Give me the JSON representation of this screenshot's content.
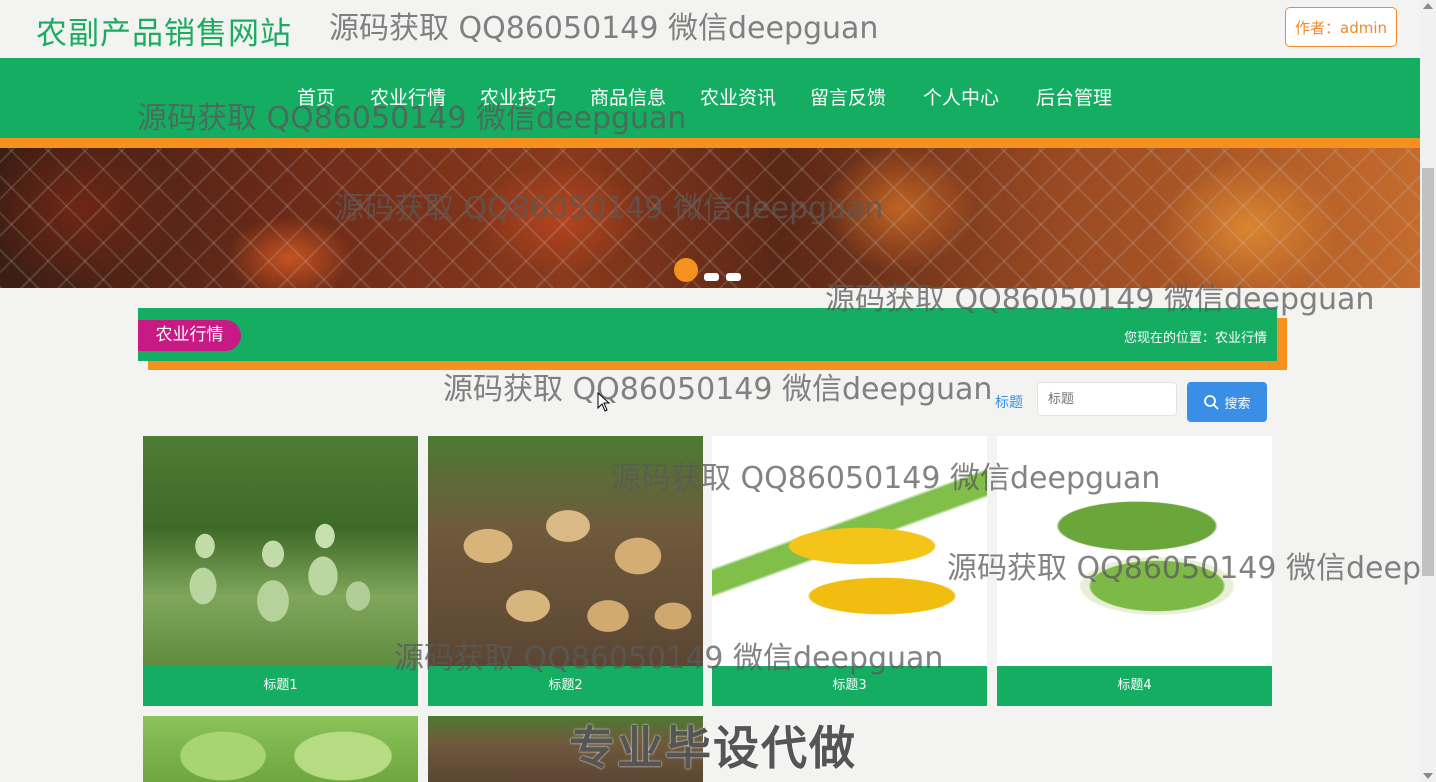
{
  "header": {
    "site_title": "农副产品销售网站",
    "author_button": "作者：admin"
  },
  "nav": {
    "items": [
      "首页",
      "农业行情",
      "农业技巧",
      "商品信息",
      "农业资讯",
      "留言反馈",
      "个人中心",
      "后台管理"
    ]
  },
  "carousel": {
    "slide_count": 3,
    "active_index": 0
  },
  "section": {
    "title": "农业行情",
    "breadcrumb": "您现在的位置：农业行情"
  },
  "search": {
    "label": "标题",
    "placeholder": "标题",
    "button_label": "搜索"
  },
  "products": [
    {
      "title": "标题1",
      "image": "gourd"
    },
    {
      "title": "标题2",
      "image": "potato"
    },
    {
      "title": "标题3",
      "image": "corn"
    },
    {
      "title": "标题4",
      "image": "bitter-melon"
    },
    {
      "title": "",
      "image": "lettuce"
    },
    {
      "title": "",
      "image": "potato"
    }
  ],
  "watermarks": {
    "contact": "源码获取 QQ86050149 微信deepguan",
    "contact_cut": "源码获取 QQ86050149 微信deepgu",
    "slogan": "专业毕设代做"
  },
  "colors": {
    "brand_green": "#15ad62",
    "accent_orange": "#f6901e",
    "tag_magenta": "#c81a84",
    "search_blue": "#3a8ee6"
  }
}
